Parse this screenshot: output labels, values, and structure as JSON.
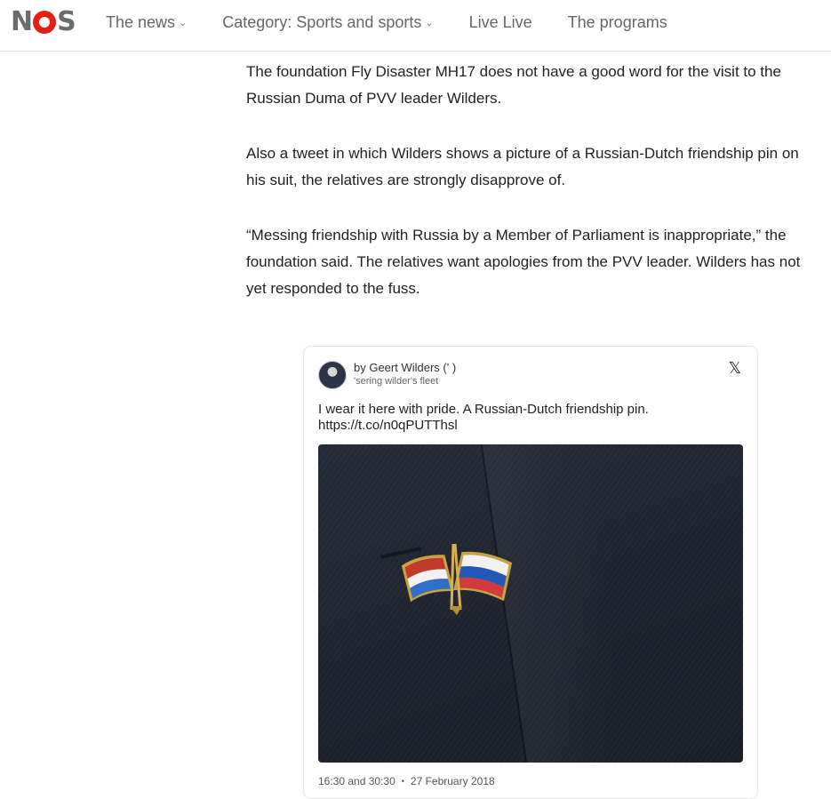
{
  "header": {
    "logo_text": "NOS",
    "nav": [
      {
        "label": "The news",
        "has_dropdown": true
      },
      {
        "label": "Category: Sports and sports",
        "has_dropdown": true
      },
      {
        "label": "Live Live",
        "has_dropdown": false
      },
      {
        "label": "The programs",
        "has_dropdown": false
      }
    ],
    "dropdown_glyph": "⌄"
  },
  "article": {
    "paragraphs": [
      "The foundation Fly Disaster MH17 does not have a good word for the visit to the Russian Duma of PVV leader Wilders.",
      "Also a tweet in which Wilders shows a picture of a Russian-Dutch friendship pin on his suit, the relatives are strongly disapprove of.",
      "“Messing friendship with Russia by a Member of Parliament is inappropriate,” the foundation said. The relatives want apologies from the PVV leader. Wilders has not yet responded to the fuss."
    ]
  },
  "tweet": {
    "author": "by Geert Wilders (' )",
    "handle": "'sering wilder's fleet",
    "platform_icon": "x-logo-icon",
    "x_glyph": "𝕏",
    "text_line1": "I wear it here with pride. A Russian-Dutch friendship pin.",
    "text_line2": "https://t.co/n0qPUTThsl",
    "time": "16:30 and 30:30",
    "date": "27 February 2018",
    "separator": "•"
  },
  "colors": {
    "brand_red": "#e61e14",
    "logo_grey": "#6b6b6b",
    "nav_text": "#666666",
    "body_text": "#222222"
  }
}
